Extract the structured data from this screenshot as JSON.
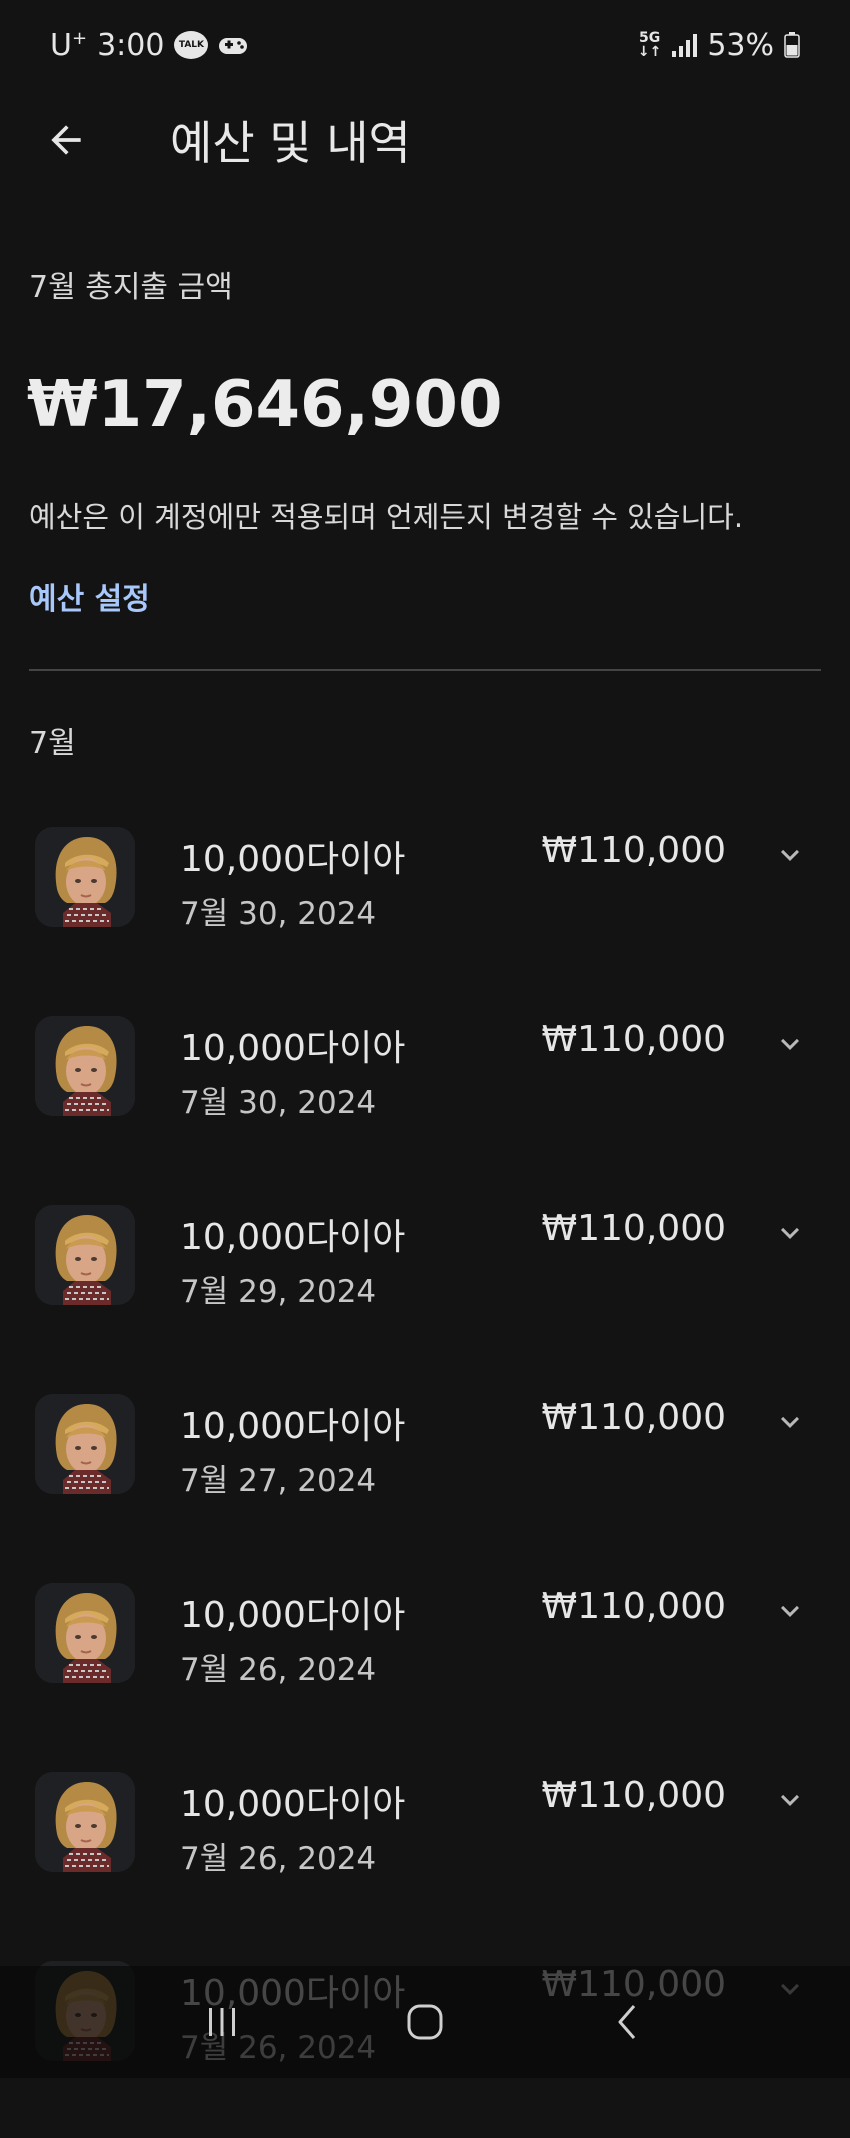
{
  "status_bar": {
    "carrier": "U",
    "carrier_plus": "+",
    "time": "3:00",
    "talk_badge": "TALK",
    "network": "5G",
    "battery": "53%"
  },
  "header": {
    "title": "예산 및 내역"
  },
  "summary": {
    "label": "7월 총지출 금액",
    "amount": "₩17,646,900",
    "note": "예산은 이 계정에만 적용되며 언제든지 변경할 수 있습니다.",
    "budget_link": "예산 설정"
  },
  "month": "7월",
  "transactions": [
    {
      "name": "10,000다이아",
      "date": "7월 30, 2024",
      "amount": "₩110,000"
    },
    {
      "name": "10,000다이아",
      "date": "7월 30, 2024",
      "amount": "₩110,000"
    },
    {
      "name": "10,000다이아",
      "date": "7월 29, 2024",
      "amount": "₩110,000"
    },
    {
      "name": "10,000다이아",
      "date": "7월 27, 2024",
      "amount": "₩110,000"
    },
    {
      "name": "10,000다이아",
      "date": "7월 26, 2024",
      "amount": "₩110,000"
    },
    {
      "name": "10,000다이아",
      "date": "7월 26, 2024",
      "amount": "₩110,000"
    },
    {
      "name": "10,000다이아",
      "date": "7월 26, 2024",
      "amount": "₩110,000"
    }
  ],
  "icons": {
    "back": "arrow-back-icon",
    "expand": "chevron-down-icon",
    "nav_recents": "recents-icon",
    "nav_home": "home-icon",
    "nav_back": "back-icon"
  },
  "colors": {
    "background": "#131313",
    "text": "#e6e6e6",
    "accent_link": "#a8c7fa",
    "divider": "#454545"
  }
}
